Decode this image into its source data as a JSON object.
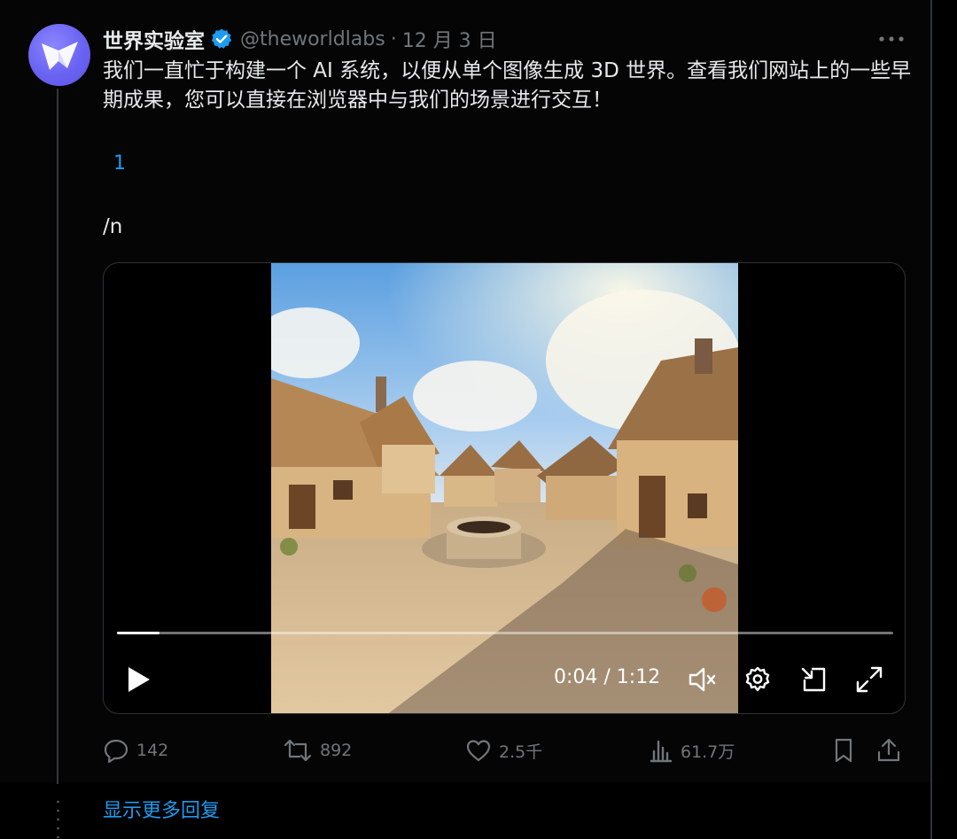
{
  "tweet": {
    "display_name": "世界实验室",
    "handle": "@theworldlabs",
    "separator": "·",
    "date": "12 月 3 日",
    "text": "我们一直忙于构建一个 AI 系统，以便从单个图像生成 3D 世界。查看我们网站上的一些早期成果，您可以直接在浏览器中与我们的场景进行交互！",
    "link_text": "1",
    "extra_text": "/n",
    "verified": true
  },
  "video": {
    "current_time": "0:04",
    "duration": "1:12",
    "time_display": "0:04 / 1:12",
    "progress": 0.055,
    "muted": true
  },
  "actions": {
    "replies": "142",
    "reposts": "892",
    "likes": "2.5千",
    "views": "61.7万"
  },
  "show_more_replies": "显示更多回复",
  "colors": {
    "accent": "#1d9bf0",
    "text": "#e7e9ea",
    "muted": "#71767b",
    "background": "#050505"
  },
  "icons": [
    "more-icon",
    "verified-icon",
    "play-icon",
    "mute-icon",
    "settings-icon",
    "pip-icon",
    "fullscreen-icon",
    "reply-icon",
    "repost-icon",
    "like-icon",
    "views-icon",
    "bookmark-icon",
    "share-icon"
  ]
}
